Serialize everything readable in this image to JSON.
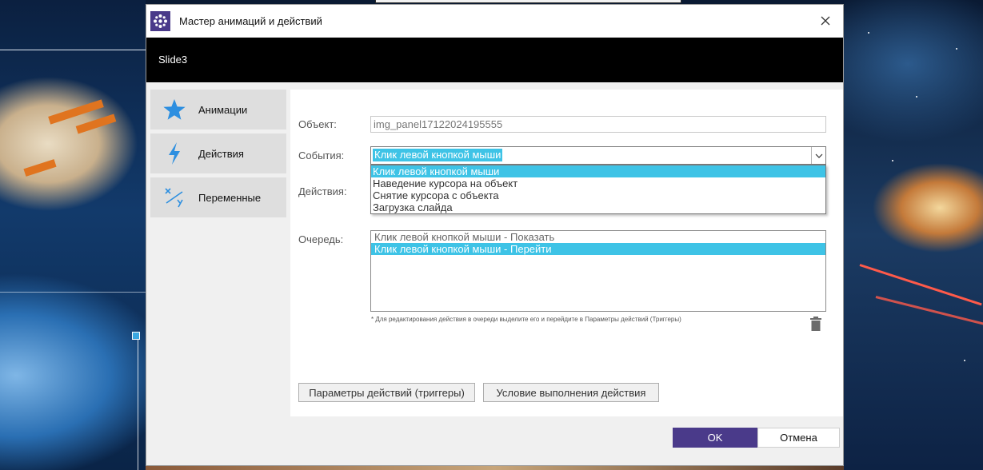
{
  "dialog": {
    "title": "Мастер анимаций и действий",
    "slide_name": "Slide3",
    "icons": {
      "logo": "app-logo-icon",
      "close": "close-icon"
    }
  },
  "sidebar": {
    "items": [
      {
        "label": "Анимации",
        "icon": "star-icon"
      },
      {
        "label": "Действия",
        "icon": "lightning-icon"
      },
      {
        "label": "Переменные",
        "icon": "variables-icon"
      }
    ]
  },
  "form": {
    "object_label": "Объект:",
    "object_value": "img_panel17122024195555",
    "events_label": "События:",
    "events_selected": "Клик левой кнопкой мыши",
    "events_options": [
      "Клик левой кнопкой мыши",
      "Наведение курсора на объект",
      "Снятие курсора с объекта",
      "Загрузка слайда"
    ],
    "actions_label": "Действия:",
    "queue_label": "Очередь:",
    "queue_items": [
      "Клик левой кнопкой мыши - Показать",
      "Клик левой кнопкой мыши - Перейти"
    ],
    "hint": "* Для редактирования действия в очереди выделите его и перейдите в Параметры действий (Триггеры)"
  },
  "buttons": {
    "params": "Параметры действий (триггеры)",
    "condition": "Условие выполнения действия",
    "ok": "OK",
    "cancel": "Отмена"
  },
  "colors": {
    "accent": "#4a3a8a",
    "selection": "#3ec3e6",
    "icon_blue": "#2d8fe0"
  }
}
